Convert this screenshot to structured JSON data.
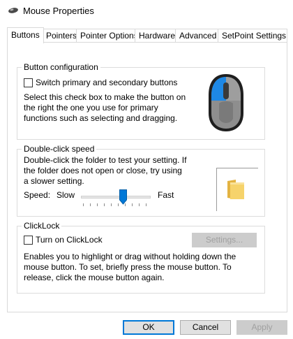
{
  "window": {
    "title": "Mouse Properties",
    "icon": "mouse-icon"
  },
  "tabs": [
    {
      "label": "Buttons",
      "active": true
    },
    {
      "label": "Pointers"
    },
    {
      "label": "Pointer Options"
    },
    {
      "label": "Hardware"
    },
    {
      "label": "Advanced"
    },
    {
      "label": "SetPoint Settings"
    }
  ],
  "button_config": {
    "legend": "Button configuration",
    "switch_label": "Switch primary and secondary buttons",
    "switch_checked": false,
    "description": "Select this check box to make the button on the right the one you use for primary functions such as selecting and dragging.",
    "accent_color": "#1e88e5"
  },
  "double_click": {
    "legend": "Double-click speed",
    "description": "Double-click the folder to test your setting. If the folder does not open or close, try using a slower setting.",
    "speed_label": "Speed:",
    "slow_label": "Slow",
    "fast_label": "Fast",
    "speed_fraction": 0.6,
    "folder_icon": "folder-icon"
  },
  "clicklock": {
    "legend": "ClickLock",
    "checkbox_label": "Turn on ClickLock",
    "checked": false,
    "settings_button": "Settings...",
    "description": "Enables you to highlight or drag without holding down the mouse button. To set, briefly press the mouse button. To release, click the mouse button again."
  },
  "footer": {
    "ok": "OK",
    "cancel": "Cancel",
    "apply": "Apply"
  },
  "colors": {
    "default_button_border": "#0078d7",
    "disabled_text": "#a0a0a0"
  }
}
